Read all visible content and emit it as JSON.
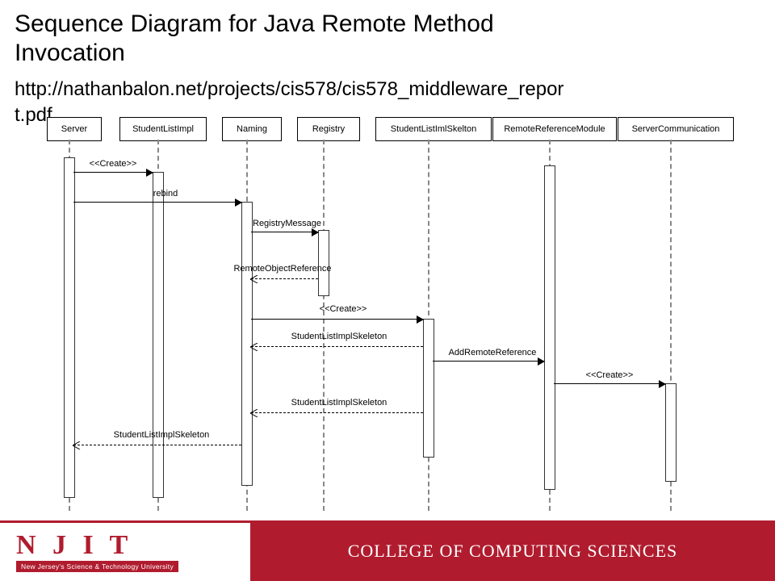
{
  "title_line1": "Sequence Diagram for Java Remote Method",
  "title_line2": "Invocation",
  "url_line1": "http://nathanbalon.net/projects/cis578/cis578_middleware_repor",
  "url_line2": "t.pdf",
  "participants": [
    "Server",
    "StudentListImpl",
    "Naming",
    "Registry",
    "StudentListImlSkelton",
    "RemoteReferenceModule",
    "ServerCommunication"
  ],
  "messages": {
    "m1": "<<Create>>",
    "m2": "rebind",
    "m3": "RegistryMessage",
    "m4": "RemoteObjectReference",
    "m5": "<<Create>>",
    "m6": "StudentListImplSkeleton",
    "m7": "AddRemoteReference",
    "m8": "<<Create>>",
    "m9": "StudentListImplSkeleton",
    "m10": "StudentListImplSkeleton"
  },
  "footer": {
    "logo_text": "N J I T",
    "logo_tag": "New Jersey's Science & Technology University",
    "college": "COLLEGE OF COMPUTING SCIENCES"
  },
  "px": {
    "p0": 55,
    "p1": 165,
    "p2": 275,
    "p3": 370,
    "p4": 500,
    "p5": 650,
    "p6": 800
  }
}
